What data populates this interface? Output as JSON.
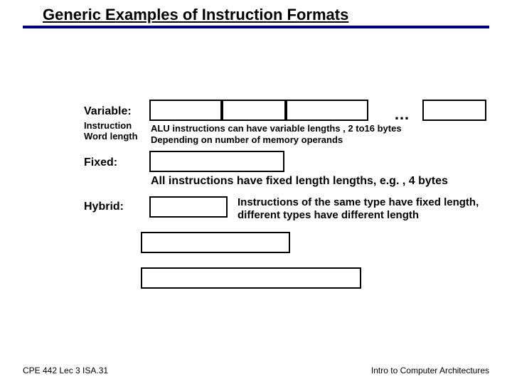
{
  "title": "Generic Examples of Instruction Formats",
  "variable": {
    "label": "Variable:",
    "sublabel_line1": "Instruction",
    "sublabel_line2": "Word length",
    "note_line1": "ALU instructions can have variable lengths , 2 to16 bytes",
    "note_line2": "Depending on number of memory operands",
    "ellipsis": "…"
  },
  "fixed": {
    "label": "Fixed:",
    "note": "All instructions have fixed length lengths, e.g. , 4 bytes"
  },
  "hybrid": {
    "label": "Hybrid:",
    "note": "Instructions of the same type have fixed length, different types have different length"
  },
  "footer": {
    "left": "CPE 442 Lec 3 ISA.31",
    "right": "Intro to Computer Architectures"
  }
}
